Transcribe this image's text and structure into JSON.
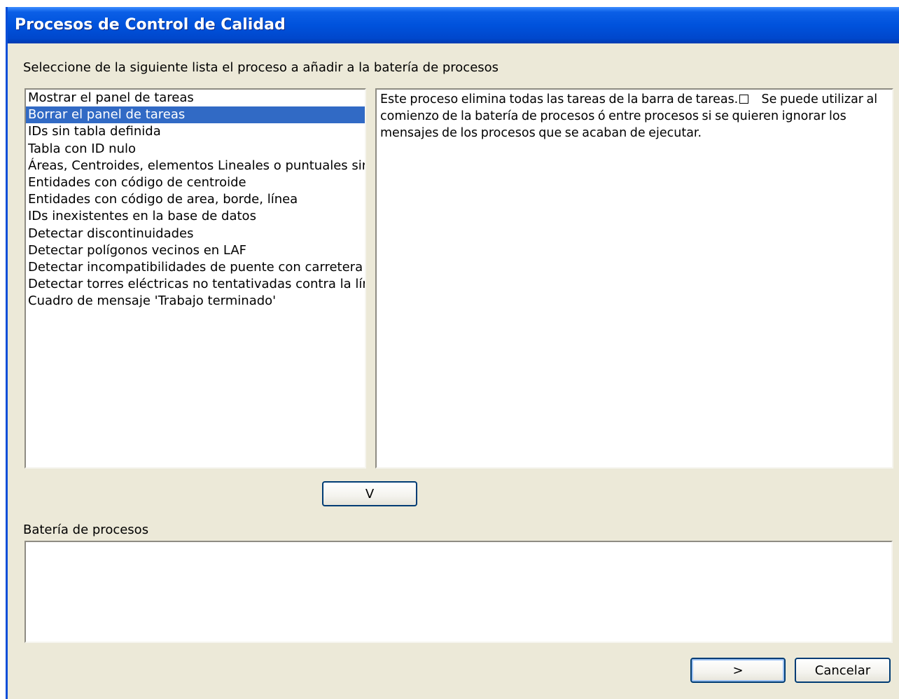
{
  "window": {
    "title": "Procesos de Control de Calidad"
  },
  "instructions": "Seleccione de la siguiente lista el proceso a añadir a la batería de procesos",
  "process_list": {
    "selected_index": 1,
    "items": [
      "Mostrar el panel de tareas",
      "Borrar el panel de tareas",
      "IDs sin tabla definida",
      "Tabla con ID nulo",
      "Áreas, Centroides, elementos Lineales o puntuales sir",
      "Entidades con código de centroide",
      "Entidades con código de area, borde, línea",
      "IDs inexistentes en la base de datos",
      "Detectar discontinuidades",
      "Detectar polígonos vecinos en LAF",
      "Detectar incompatibilidades de puente con carretera",
      "Detectar torres eléctricas no tentativadas contra la lír",
      "Cuadro de mensaje 'Trabajo terminado'"
    ]
  },
  "description": {
    "part1": "Este proceso elimina todas las tareas de la barra de tareas.",
    "part2": "    Se puede utilizar al comienzo de la batería de procesos ó entre procesos si se quieren ignorar los mensajes de los procesos que se acaban de ejecutar."
  },
  "buttons": {
    "add": "V",
    "next": ">",
    "cancel": "Cancelar"
  },
  "battery": {
    "label": "Batería de procesos",
    "items": []
  }
}
